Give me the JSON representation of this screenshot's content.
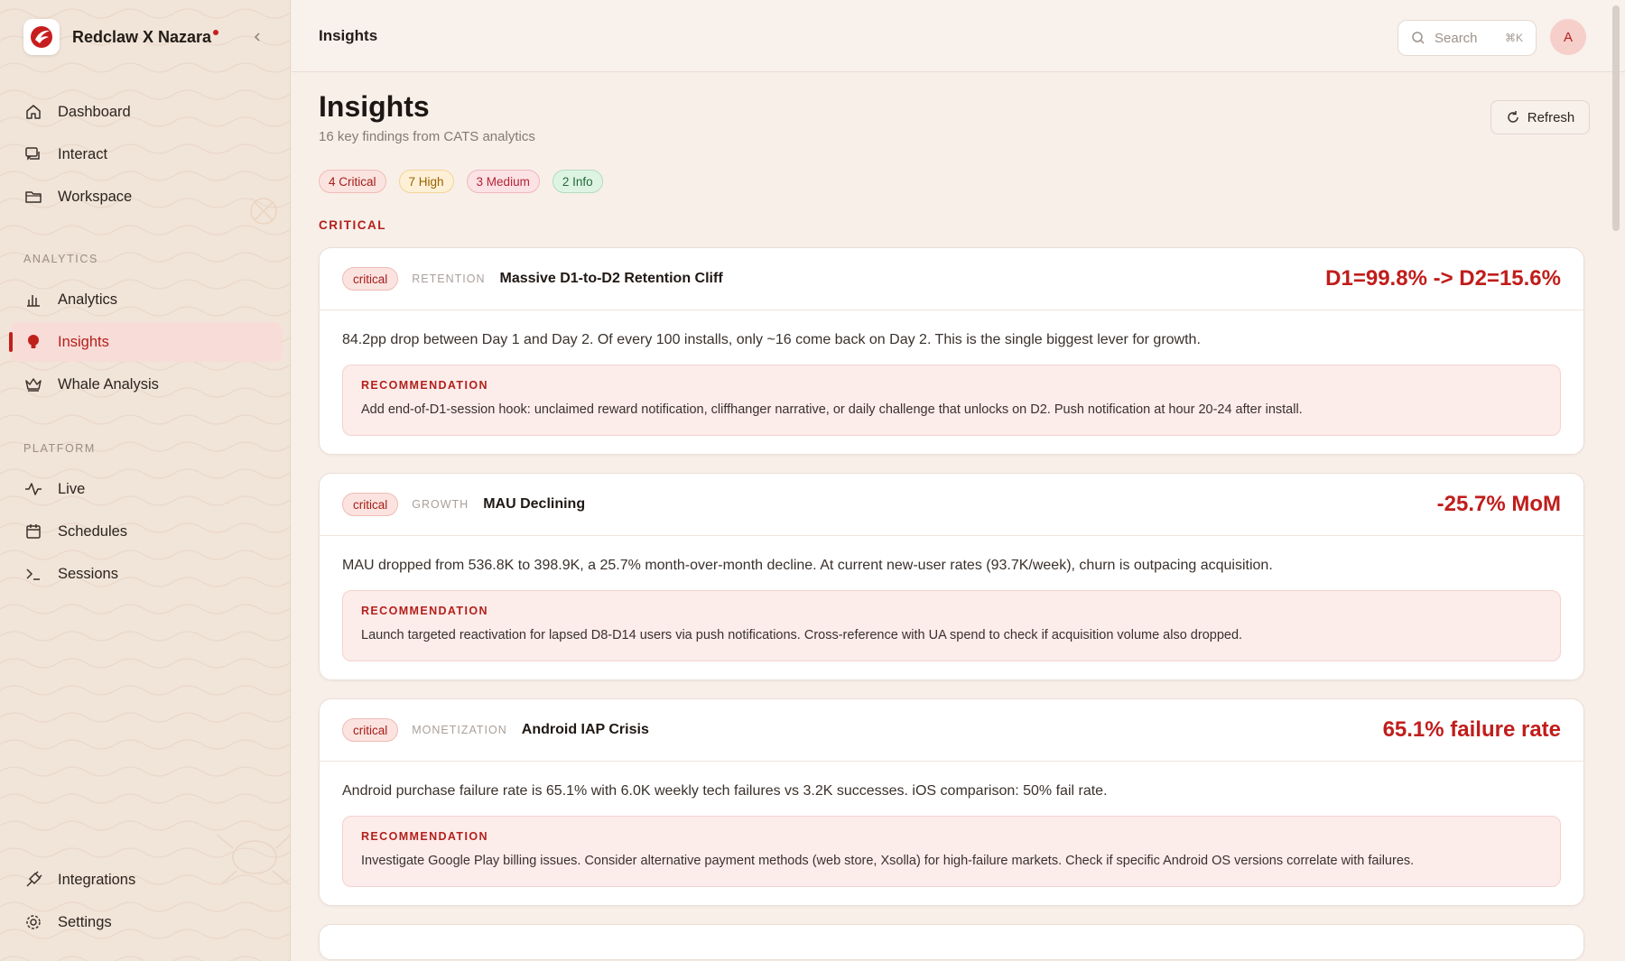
{
  "brand": {
    "name": "Redclaw X Nazara"
  },
  "sidebar": {
    "main_items": [
      {
        "label": "Dashboard",
        "icon": "home-icon"
      },
      {
        "label": "Interact",
        "icon": "chat-icon"
      },
      {
        "label": "Workspace",
        "icon": "folder-icon"
      }
    ],
    "analytics_label": "ANALYTICS",
    "analytics_items": [
      {
        "label": "Analytics",
        "icon": "bar-chart-icon"
      },
      {
        "label": "Insights",
        "icon": "lightbulb-icon",
        "active": true
      },
      {
        "label": "Whale Analysis",
        "icon": "crown-icon"
      }
    ],
    "platform_label": "PLATFORM",
    "platform_items": [
      {
        "label": "Live",
        "icon": "pulse-icon"
      },
      {
        "label": "Schedules",
        "icon": "calendar-icon"
      },
      {
        "label": "Sessions",
        "icon": "terminal-icon"
      }
    ],
    "bottom_items": [
      {
        "label": "Integrations",
        "icon": "plug-icon"
      },
      {
        "label": "Settings",
        "icon": "gear-icon"
      }
    ]
  },
  "header": {
    "title": "Insights",
    "search_placeholder": "Search",
    "search_shortcut": "⌘K",
    "avatar_initial": "A"
  },
  "page": {
    "title": "Insights",
    "subtitle": "16 key findings from CATS analytics",
    "refresh_label": "Refresh",
    "chips": {
      "critical": "4 Critical",
      "high": "7 High",
      "medium": "3 Medium",
      "info": "2 Info"
    },
    "section_label": "CRITICAL"
  },
  "colors": {
    "accent": "#c01d1b",
    "sidebar_bg": "#f1e4d8",
    "main_bg": "#f8efe9",
    "recommendation_bg": "#fcecea"
  },
  "insights": [
    {
      "severity": "critical",
      "category": "RETENTION",
      "title": "Massive D1-to-D2 Retention Cliff",
      "metric": "D1=99.8% -> D2=15.6%",
      "description": "84.2pp drop between Day 1 and Day 2. Of every 100 installs, only ~16 come back on Day 2. This is the single biggest lever for growth.",
      "recommendation_label": "RECOMMENDATION",
      "recommendation": "Add end-of-D1-session hook: unclaimed reward notification, cliffhanger narrative, or daily challenge that unlocks on D2. Push notification at hour 20-24 after install."
    },
    {
      "severity": "critical",
      "category": "GROWTH",
      "title": "MAU Declining",
      "metric": "-25.7% MoM",
      "description": "MAU dropped from 536.8K to 398.9K, a 25.7% month-over-month decline. At current new-user rates (93.7K/week), churn is outpacing acquisition.",
      "recommendation_label": "RECOMMENDATION",
      "recommendation": "Launch targeted reactivation for lapsed D8-D14 users via push notifications. Cross-reference with UA spend to check if acquisition volume also dropped."
    },
    {
      "severity": "critical",
      "category": "MONETIZATION",
      "title": "Android IAP Crisis",
      "metric": "65.1% failure rate",
      "description": "Android purchase failure rate is 65.1% with 6.0K weekly tech failures vs 3.2K successes. iOS comparison: 50% fail rate.",
      "recommendation_label": "RECOMMENDATION",
      "recommendation": "Investigate Google Play billing issues. Consider alternative payment methods (web store, Xsolla) for high-failure markets. Check if specific Android OS versions correlate with failures."
    }
  ]
}
